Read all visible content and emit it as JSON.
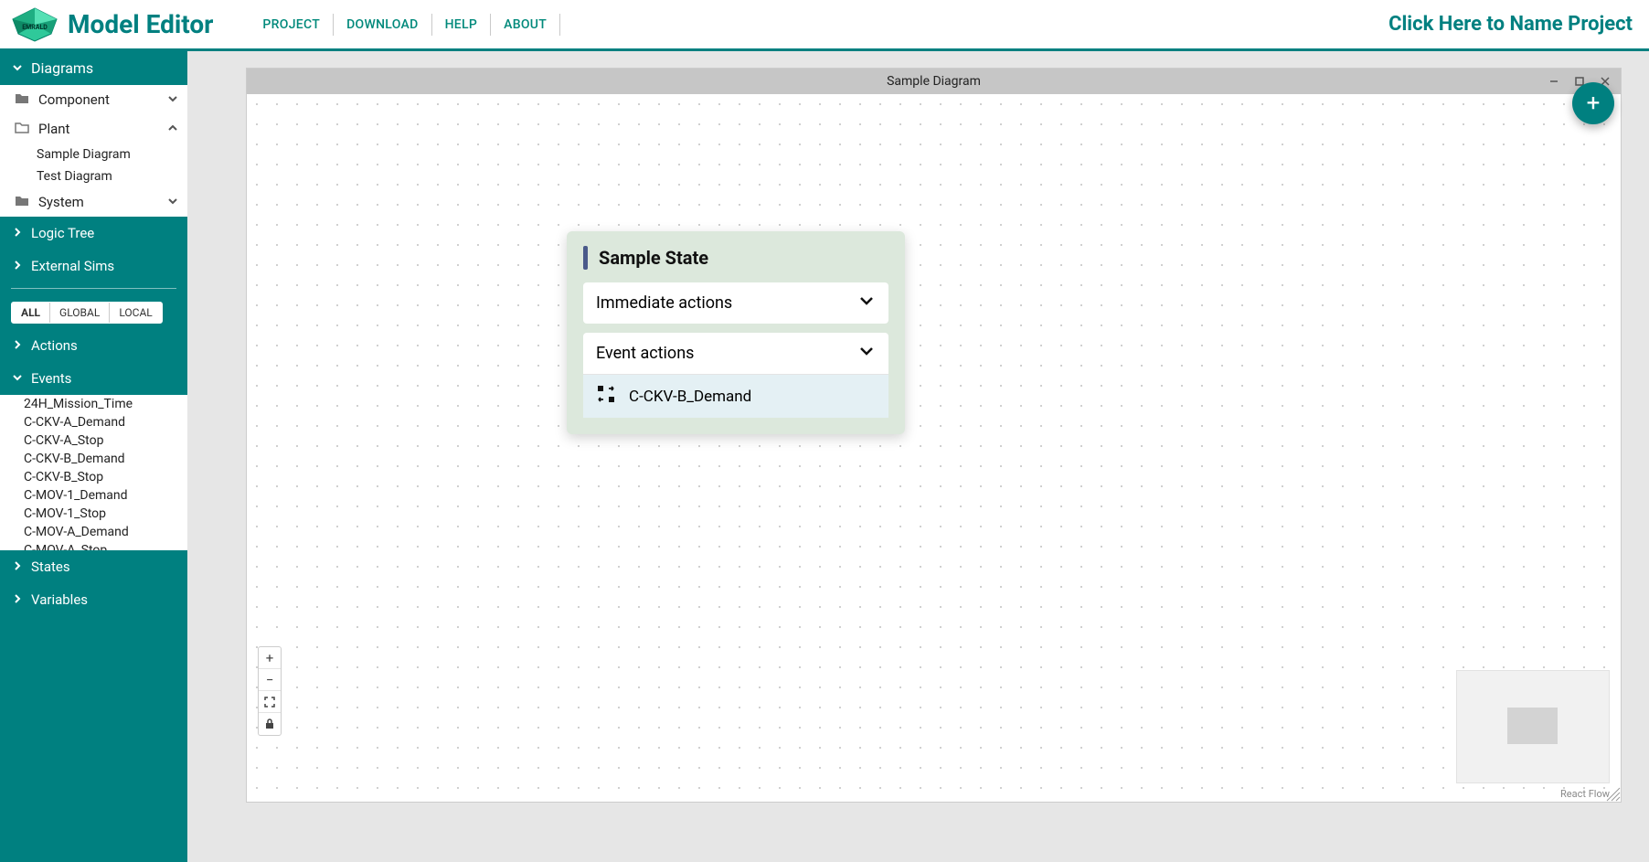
{
  "app": {
    "title": "Model Editor"
  },
  "menu": {
    "items": [
      "PROJECT",
      "DOWNLOAD",
      "HELP",
      "ABOUT"
    ]
  },
  "project_name_placeholder": "Click Here to Name Project",
  "sidebar": {
    "sections": {
      "diagrams": {
        "label": "Diagrams",
        "expanded": true
      },
      "logic_tree": {
        "label": "Logic Tree",
        "expanded": false
      },
      "external_sims": {
        "label": "External Sims",
        "expanded": false
      },
      "actions": {
        "label": "Actions",
        "expanded": false
      },
      "events": {
        "label": "Events",
        "expanded": true
      },
      "states": {
        "label": "States",
        "expanded": false
      },
      "variables": {
        "label": "Variables",
        "expanded": false
      }
    },
    "diagram_groups": [
      {
        "name": "Component",
        "expanded": false,
        "items": []
      },
      {
        "name": "Plant",
        "expanded": true,
        "items": [
          "Sample Diagram",
          "Test Diagram"
        ]
      },
      {
        "name": "System",
        "expanded": false,
        "items": []
      }
    ],
    "filters": {
      "options": [
        "ALL",
        "GLOBAL",
        "LOCAL"
      ],
      "active": "ALL"
    },
    "events_list": [
      "24H_Mission_Time",
      "C-CKV-A_Demand",
      "C-CKV-A_Stop",
      "C-CKV-B_Demand",
      "C-CKV-B_Stop",
      "C-MOV-1_Demand",
      "C-MOV-1_Stop",
      "C-MOV-A_Demand",
      "C-MOV-A_Stop"
    ]
  },
  "canvas": {
    "window_title": "Sample Diagram",
    "attribution": "React Flow",
    "state_node": {
      "title": "Sample State",
      "immediate_label": "Immediate actions",
      "event_label": "Event actions",
      "event_items": [
        "C-CKV-B_Demand"
      ]
    }
  }
}
